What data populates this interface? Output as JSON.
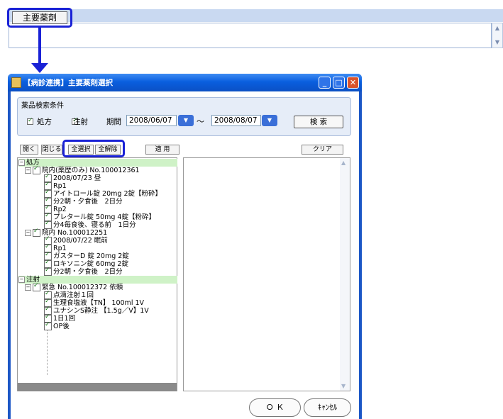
{
  "top": {
    "main_drug_button": "主要薬剤"
  },
  "window": {
    "title": "【病診連携】主要薬剤選択",
    "min_btn": "_",
    "max_btn": "□",
    "close_btn": "✕"
  },
  "search": {
    "title": "薬品検索条件",
    "rx_label": "処方",
    "rx_checked": true,
    "inj_label": "注射",
    "inj_checked": true,
    "period_label": "期間",
    "date_from": "2008/06/07",
    "date_to": "2008/08/07",
    "tilde": "～",
    "search_button": "検 索"
  },
  "toolbar": {
    "open": "開く",
    "close": "閉じる",
    "select_all": "全選択",
    "clear_all": "全解除",
    "apply": "適 用",
    "clear": "クリア"
  },
  "tree": {
    "s0": "処方",
    "i1": "院内(薬歴のみ) No.100012361",
    "i2": "2008/07/23 昼",
    "i3": "Rp1",
    "i4": "アイトロール錠 20mg 2錠【粉砕】",
    "i5": "分2朝・夕食後　2日分",
    "i6": "Rp2",
    "i7": "プレタール錠 50mg 4錠【粉砕】",
    "i8": "分4毎食後、寝る前　1日分",
    "i9": "院内 No.100012251",
    "i10": "2008/07/22 眠前",
    "i11": "Rp1",
    "i12": "ガスターD 錠 20mg 2錠",
    "i13": "ロキソニン錠 60mg 2錠",
    "i14": "分2朝・夕食後　2日分",
    "s1": "注射",
    "i15": "緊急 No.100012372 依頼",
    "i16": "点滴注射１回",
    "i17": "生理食塩液【TN】 100ml 1V",
    "i18": "ユナシンS静注 【1.5g／V】1V",
    "i19": "1日1回",
    "i20": "OP後"
  },
  "footer": {
    "ok": "Ｏ Ｋ",
    "cancel": "ｷｬﾝｾﾙ"
  },
  "colors": {
    "highlight": "#1a22d6",
    "titlebar": "#0a5fdf",
    "section_bg": "#cff2c7"
  }
}
